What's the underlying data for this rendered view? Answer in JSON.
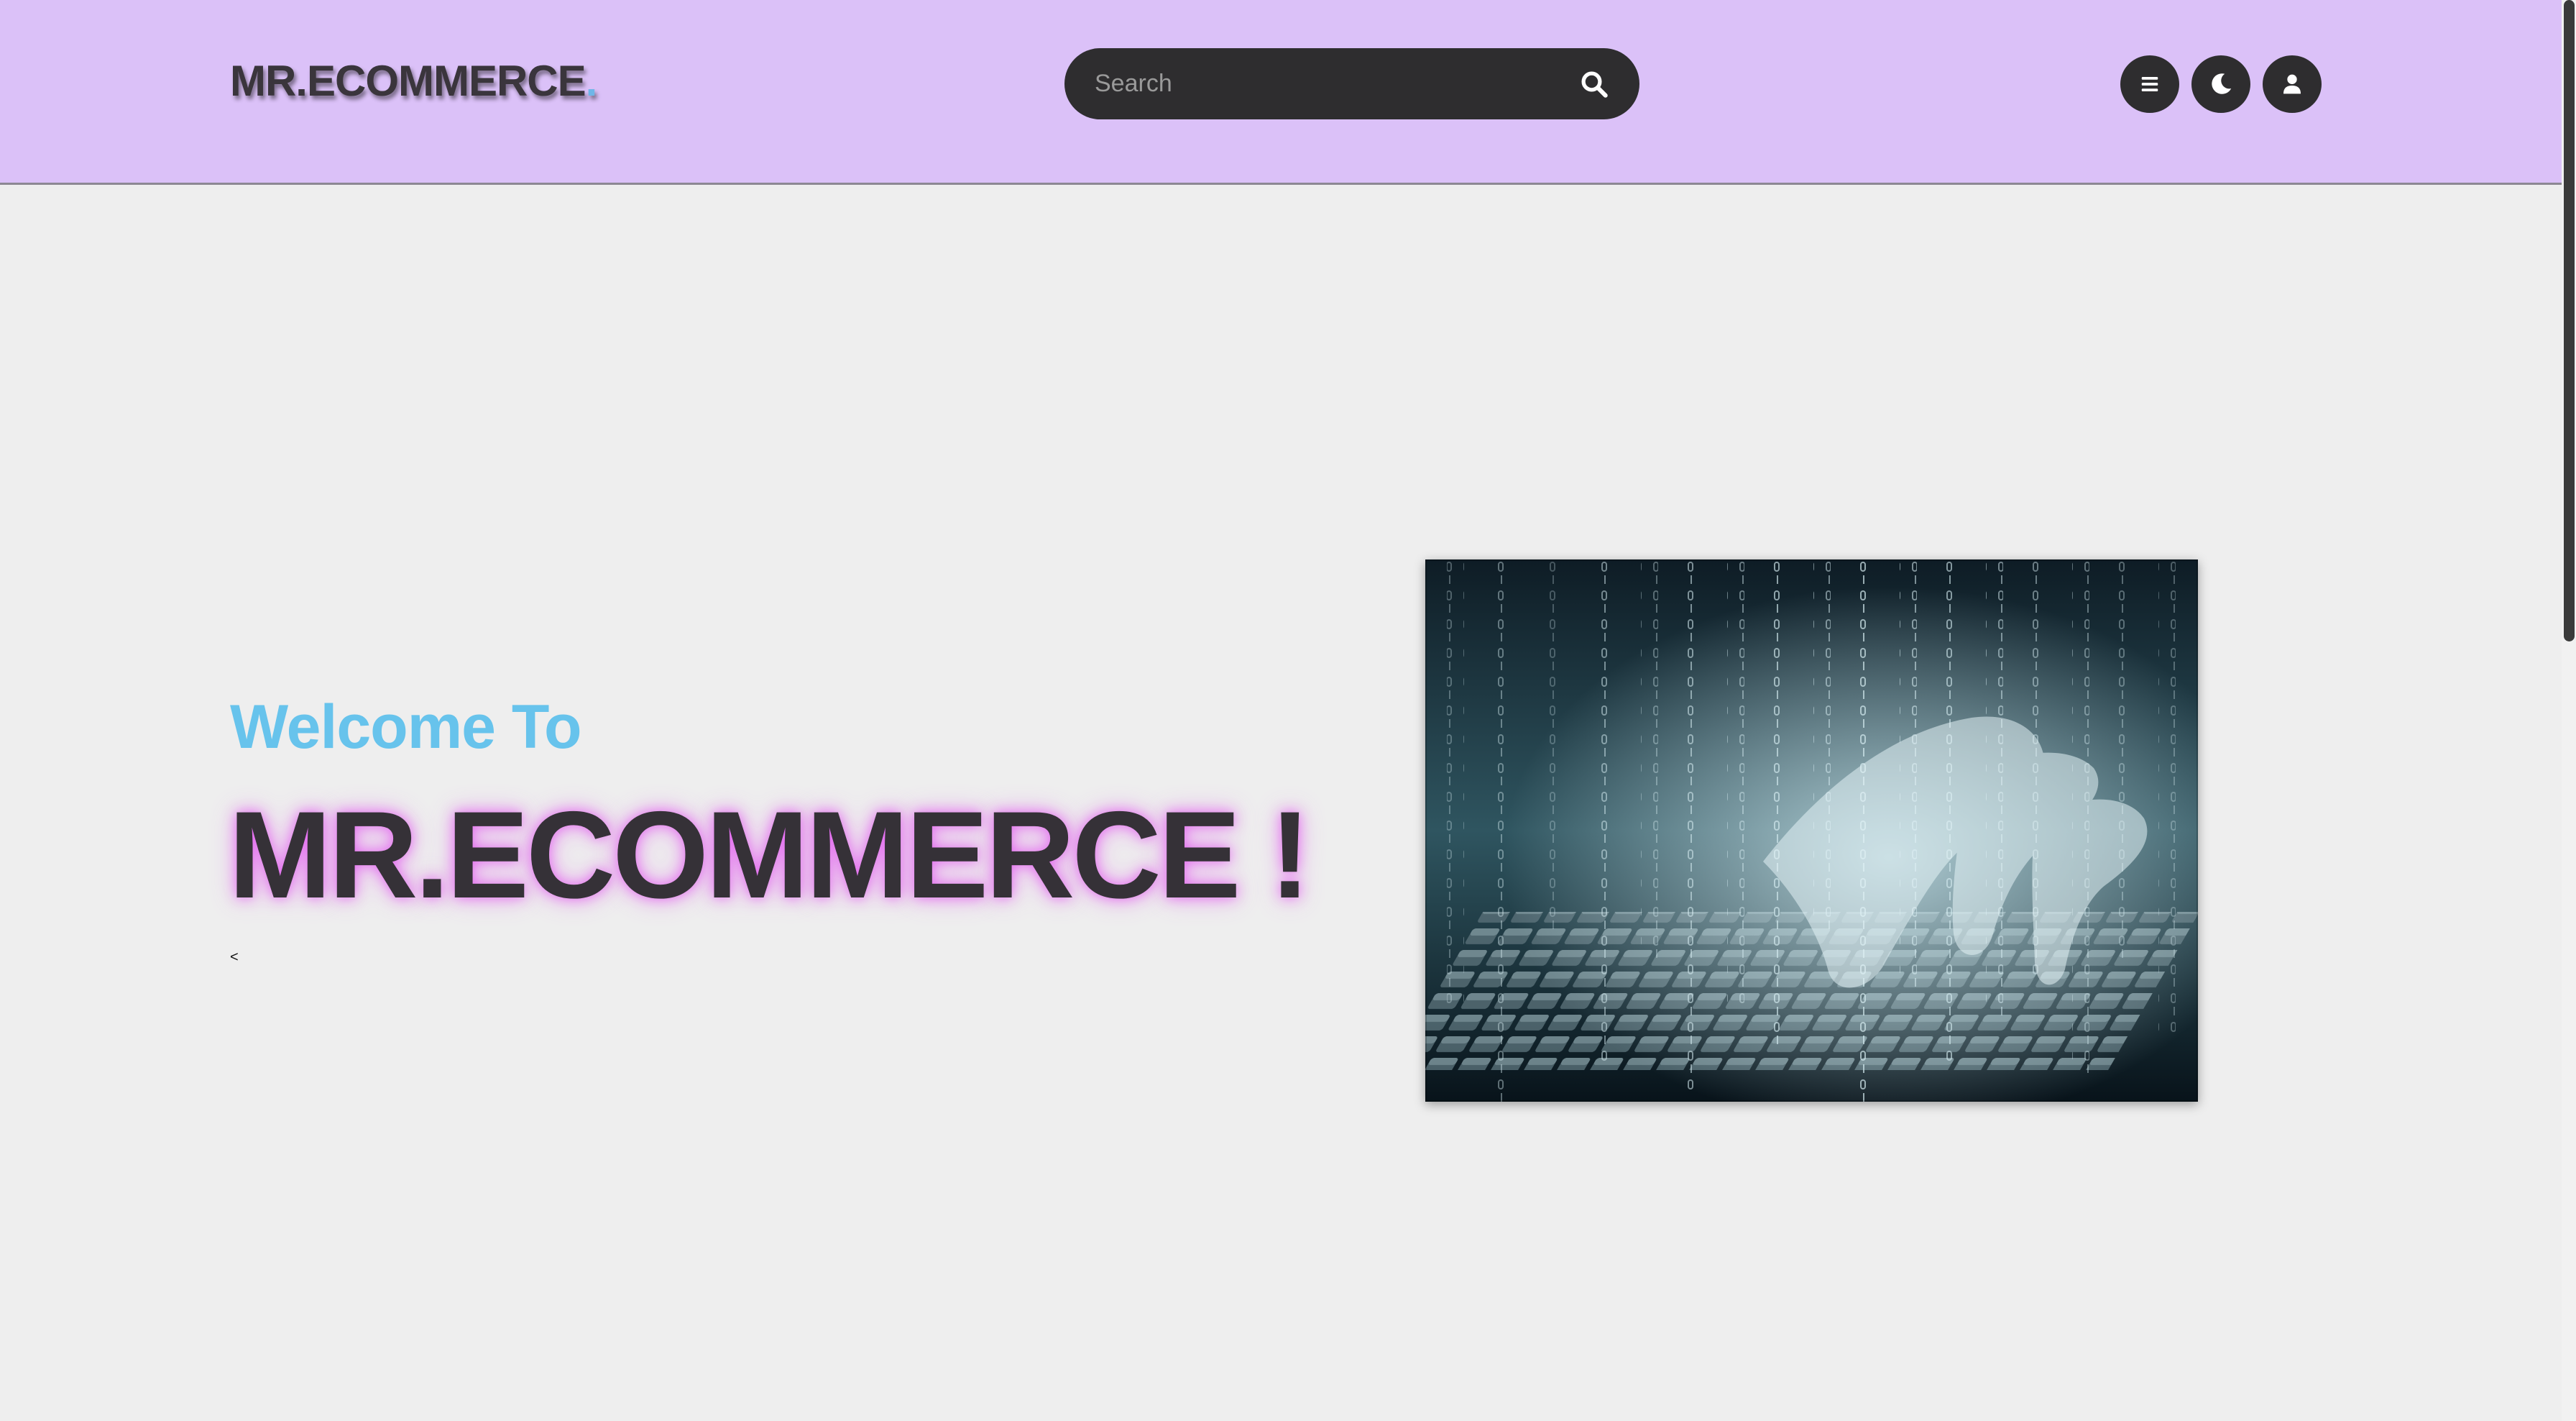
{
  "header": {
    "logo_text": "MR.ECOMMERCE",
    "logo_dot": ".",
    "search_placeholder": "Search",
    "icons": {
      "search": "search-icon",
      "menu": "menu-icon",
      "theme": "moon-icon",
      "user": "user-icon"
    }
  },
  "hero": {
    "welcome": "Welcome To",
    "title": "MR.ECOMMERCE !",
    "small_char": "<",
    "image": "binary-code-hands-keyboard-image"
  },
  "colors": {
    "header_bg": "#dbc1f8",
    "page_bg": "#eeeeee",
    "accent_blue": "#67c3ec",
    "dark": "#2e2d2f",
    "glow": "#e258f0"
  }
}
